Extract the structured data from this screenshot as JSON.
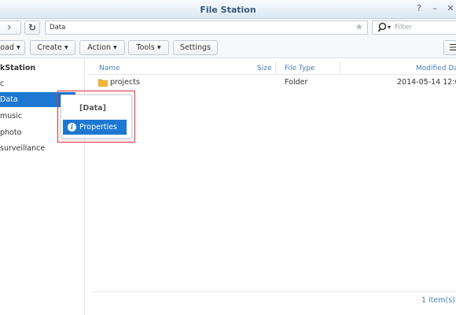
{
  "window": {
    "title": "File Station",
    "help_glyph": "?",
    "minimize_glyph": "–",
    "close_glyph": "✕"
  },
  "nav": {
    "back_glyph": "‹",
    "forward_glyph": "›",
    "refresh_glyph": "↻",
    "path": "Data",
    "star_glyph": "★",
    "filter_placeholder": "Filter",
    "filter_caret": "▾"
  },
  "toolbar": {
    "upload_label": "oad ▾",
    "create_label": "Create ▾",
    "action_label": "Action ▾",
    "tools_label": "Tools ▾",
    "settings_label": "Settings",
    "view_glyph": "☰"
  },
  "sidebar": {
    "root": "kStation",
    "items": [
      {
        "label": "c"
      },
      {
        "label": "Data"
      },
      {
        "label": "music"
      },
      {
        "label": "photo"
      },
      {
        "label": "surveillance"
      }
    ]
  },
  "context_menu": {
    "title": "[Data]",
    "item_label": "Properties",
    "item_icon": "i"
  },
  "file_list": {
    "columns": [
      "Name",
      "Size",
      "File Type",
      "Modified Da"
    ],
    "rows": [
      {
        "name": "projects",
        "size": "",
        "type": "Folder",
        "modified": "2014-05-14 12:0"
      }
    ]
  },
  "status": {
    "count": "1 item(s)"
  },
  "colors": {
    "accent": "#1d78d2",
    "highlight_outline": "#e0323a",
    "folder": "#f5b731"
  }
}
